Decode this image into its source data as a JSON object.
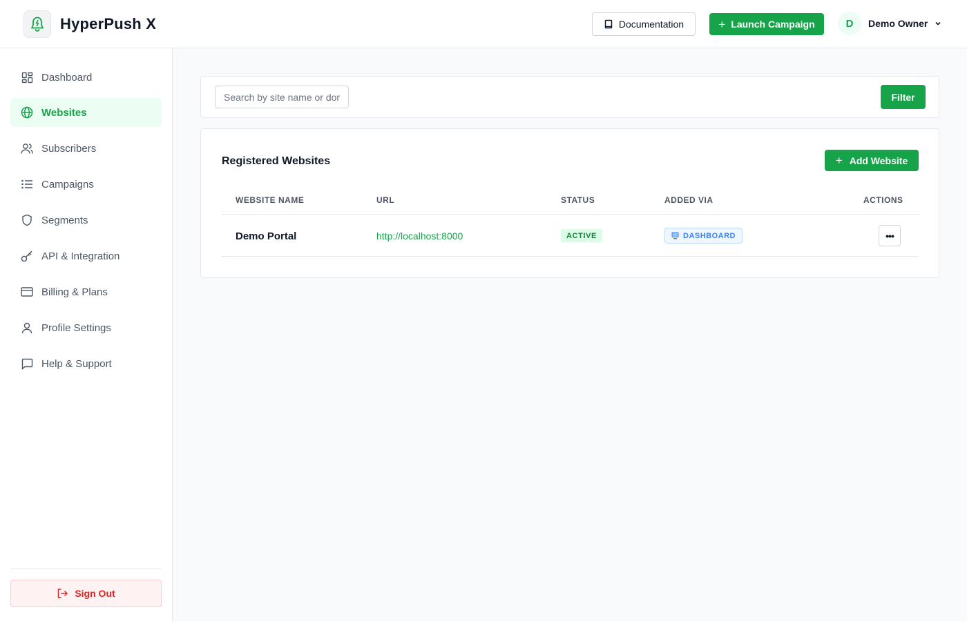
{
  "app": {
    "name": "HyperPush X",
    "logo_icon": "bell-icon"
  },
  "header": {
    "documentation_label": "Documentation",
    "launch_label": "Launch Campaign",
    "user": {
      "initial": "D",
      "name": "Demo Owner"
    }
  },
  "sidebar": {
    "items": [
      {
        "label": "Dashboard",
        "icon": "dashboard-icon"
      },
      {
        "label": "Websites",
        "icon": "globe-icon",
        "active": true
      },
      {
        "label": "Subscribers",
        "icon": "users-icon"
      },
      {
        "label": "Campaigns",
        "icon": "list-icon"
      },
      {
        "label": "Segments",
        "icon": "shield-icon"
      },
      {
        "label": "API & Integration",
        "icon": "key-icon"
      },
      {
        "label": "Billing & Plans",
        "icon": "credit-card-icon"
      },
      {
        "label": "Profile Settings",
        "icon": "user-icon"
      },
      {
        "label": "Help & Support",
        "icon": "chat-icon"
      }
    ],
    "signout_label": "Sign Out"
  },
  "search": {
    "placeholder": "Search by site name or domain",
    "filter_label": "Filter"
  },
  "websites": {
    "title": "Registered Websites",
    "add_label": "Add Website",
    "columns": [
      "WEBSITE NAME",
      "URL",
      "STATUS",
      "ADDED VIA",
      "ACTIONS"
    ],
    "rows": [
      {
        "name": "Demo Portal",
        "url": "http://localhost:8000",
        "status": "ACTIVE",
        "added_via": "DASHBOARD"
      }
    ]
  },
  "colors": {
    "accent": "#16a34a",
    "danger": "#dc2626",
    "info": "#3b82f6"
  }
}
